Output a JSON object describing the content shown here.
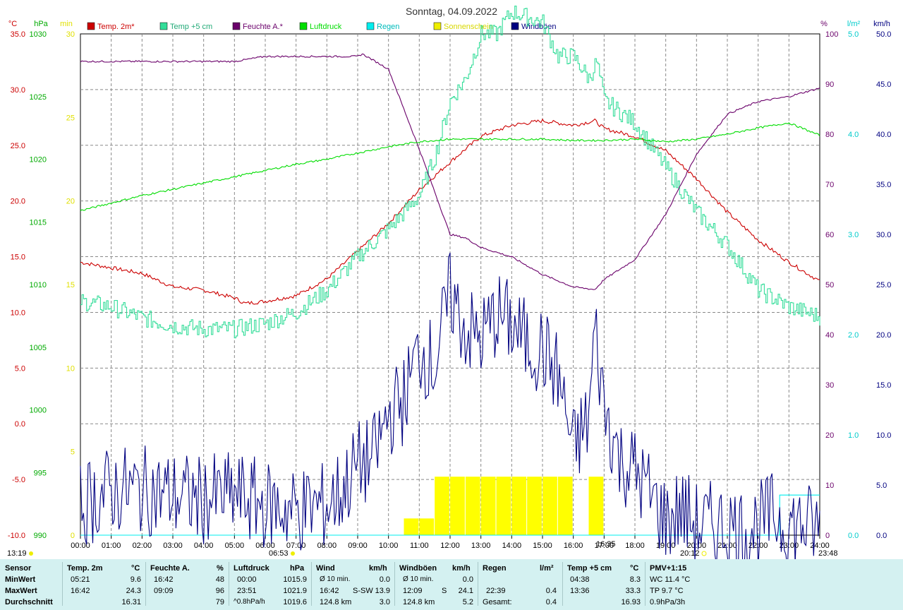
{
  "chart_data": {
    "type": "line",
    "title": "Sonntag, 04.09.2022",
    "left_axes": [
      {
        "unit": "°C",
        "color": "#cc0000",
        "ticks": [
          "35.0",
          "30.0",
          "25.0",
          "20.0",
          "15.0",
          "10.0",
          "5.0",
          "0.0",
          "-5.0",
          "-10.0"
        ],
        "range": [
          -10,
          35
        ]
      },
      {
        "unit": "hPa",
        "color": "#00aa00",
        "ticks": [
          "1030",
          "1025",
          "1020",
          "1015",
          "1010",
          "1005",
          "1000",
          "995",
          "990"
        ],
        "range": [
          990,
          1030
        ]
      },
      {
        "unit": "min",
        "color": "#e0e000",
        "ticks": [
          "30",
          "25",
          "20",
          "15",
          "10",
          "5",
          "0"
        ],
        "range": [
          0,
          30
        ]
      }
    ],
    "right_axes": [
      {
        "unit": "%",
        "color": "#6a006a",
        "ticks": [
          "100",
          "90",
          "80",
          "70",
          "60",
          "50",
          "40",
          "30",
          "20",
          "10",
          "0"
        ],
        "range": [
          0,
          100
        ]
      },
      {
        "unit": "l/m²",
        "color": "#00cccc",
        "ticks": [
          "5.0",
          "4.0",
          "3.0",
          "2.0",
          "1.0",
          "0.0"
        ],
        "range": [
          0,
          5
        ]
      },
      {
        "unit": "km/h",
        "color": "#000080",
        "ticks": [
          "50.0",
          "45.0",
          "40.0",
          "35.0",
          "30.0",
          "25.0",
          "20.0",
          "15.0",
          "10.0",
          "5.0",
          "0.0"
        ],
        "range": [
          0,
          50
        ]
      }
    ],
    "x_ticks": [
      "00:00",
      "01:00",
      "02:00",
      "03:00",
      "04:00",
      "05:00",
      "06:00",
      "07:00",
      "08:00",
      "09:00",
      "10:00",
      "11:00",
      "12:00",
      "13:00",
      "14:00",
      "15:00",
      "16:00",
      "17:00",
      "18:00",
      "19:00",
      "20:00",
      "21:00",
      "22:00",
      "23:00",
      "24:00"
    ],
    "markers": {
      "start": "13:19",
      "sunrise": "06:53",
      "sunset": "20:12",
      "peak": "16:35",
      "end": "23:48"
    },
    "legend": [
      {
        "name": "Temp. 2m*",
        "color": "#cc0000"
      },
      {
        "name": "Temp +5 cm",
        "color": "#33dd99"
      },
      {
        "name": "Feuchte A.*",
        "color": "#6a006a"
      },
      {
        "name": "Luftdruck",
        "color": "#00dd00"
      },
      {
        "name": "Regen",
        "color": "#00eeee"
      },
      {
        "name": "Sonnenschein",
        "color": "#eeee00"
      },
      {
        "name": "Windböen",
        "color": "#000080"
      }
    ],
    "series": [
      {
        "name": "Temp. 2m*",
        "axis": "°C",
        "x": [
          0,
          1,
          2,
          3,
          4,
          5,
          5.35,
          6,
          7,
          8,
          9,
          10,
          11,
          12,
          13,
          14,
          15,
          15.5,
          16,
          16.7,
          17,
          18,
          19,
          20,
          21,
          22,
          23,
          24
        ],
        "values": [
          14.5,
          14.0,
          13.5,
          12.3,
          12.0,
          11.3,
          10.8,
          11.0,
          11.5,
          13.0,
          15.5,
          18.0,
          21.0,
          23.5,
          25.8,
          26.8,
          27.2,
          27.0,
          26.8,
          27.2,
          26.5,
          25.8,
          24.5,
          22.0,
          19.0,
          16.5,
          14.5,
          12.8
        ]
      },
      {
        "name": "Temp +5 cm",
        "axis": "°C",
        "x": [
          0,
          1,
          2,
          3,
          4,
          5,
          6,
          7,
          8,
          9,
          10,
          11,
          11.5,
          12,
          12.5,
          13,
          13.5,
          14,
          14.5,
          15,
          15.5,
          16,
          16.5,
          16.75,
          17,
          18,
          19,
          20,
          21,
          22,
          23,
          24
        ],
        "values": [
          11.0,
          10.5,
          9.5,
          8.8,
          8.5,
          8.5,
          9.0,
          10.0,
          12.0,
          15.0,
          17.5,
          20.5,
          24.0,
          29.0,
          31.0,
          35.0,
          35.0,
          37.0,
          36.5,
          36.0,
          33.0,
          33.0,
          31.0,
          32.5,
          29.0,
          27.0,
          23.0,
          19.0,
          16.0,
          12.0,
          10.5,
          9.6
        ]
      },
      {
        "name": "Feuchte A.*",
        "axis": "%",
        "x": [
          0,
          1,
          2,
          3,
          4,
          5,
          6,
          7,
          8,
          9,
          9.15,
          10,
          11,
          12,
          12.5,
          13,
          14,
          15,
          16,
          16.7,
          17,
          18,
          19,
          20,
          21,
          22,
          23,
          24
        ],
        "values": [
          94.5,
          94.5,
          94.5,
          94.5,
          94.5,
          94.5,
          95.5,
          95.5,
          95.5,
          95.5,
          96,
          93,
          77,
          60,
          59.3,
          57.4,
          55.5,
          52.0,
          49.5,
          49.0,
          51.0,
          55.0,
          64.0,
          76.0,
          84.0,
          86.5,
          87.5,
          89.2
        ]
      },
      {
        "name": "Luftdruck",
        "axis": "hPa",
        "x": [
          0,
          1,
          2,
          3,
          4,
          5,
          6,
          7,
          8,
          9,
          10,
          11,
          12,
          13,
          14,
          15,
          16,
          17,
          18,
          19,
          20,
          21,
          22,
          23,
          24
        ],
        "values": [
          1015.9,
          1016.5,
          1017.1,
          1017.6,
          1018.1,
          1018.6,
          1019.1,
          1019.6,
          1020.0,
          1020.5,
          1021.0,
          1021.4,
          1021.6,
          1021.6,
          1021.6,
          1021.6,
          1021.5,
          1021.5,
          1021.6,
          1021.4,
          1021.6,
          1022.0,
          1022.5,
          1022.9,
          1021.9
        ]
      },
      {
        "name": "Regen",
        "axis": "l/m²",
        "x": [
          0,
          22.65,
          22.66,
          24
        ],
        "values": [
          0.0,
          0.0,
          0.4,
          0.4
        ]
      },
      {
        "name": "Windböen",
        "axis": "km/h",
        "x": [
          0,
          1,
          2,
          3,
          4,
          5,
          6,
          7,
          8,
          8.5,
          9,
          9.5,
          10,
          10.5,
          11,
          11.5,
          12,
          12.5,
          13,
          13.5,
          14,
          14.5,
          15,
          15.5,
          16,
          16.5,
          16.7,
          17,
          17.5,
          18,
          18.5,
          19,
          19.5,
          20,
          20.5,
          21,
          21.5,
          22,
          22.5,
          23,
          23.5,
          24
        ],
        "values": [
          3.0,
          4.5,
          4.5,
          4.0,
          3.5,
          4.0,
          3.0,
          2.5,
          3.0,
          4.5,
          7.0,
          7.5,
          12.0,
          13.5,
          18.5,
          17.0,
          24.1,
          20.5,
          19.5,
          22.0,
          21.0,
          19.0,
          18.5,
          16.0,
          8.5,
          11.5,
          20.5,
          13.0,
          7.5,
          6.5,
          4.0,
          1.5,
          2.5,
          1.0,
          1.0,
          1.0,
          0.5,
          1.0,
          2.0,
          1.0,
          1.0,
          0.5
        ]
      },
      {
        "name": "Sonnenschein",
        "axis": "min",
        "type": "bar",
        "x": [
          10.5,
          11,
          11.5,
          12,
          12.5,
          13,
          13.5,
          14,
          14.5,
          15,
          15.5,
          16.5
        ],
        "values": [
          1.0,
          1.0,
          3.5,
          3.5,
          3.5,
          3.5,
          3.5,
          3.5,
          3.5,
          3.5,
          3.5,
          3.5
        ]
      }
    ]
  },
  "stats": {
    "header": {
      "sensor": "Sensor",
      "temp": "Temp. 2m",
      "temp_unit": "°C",
      "hum": "Feuchte A.",
      "hum_unit": "%",
      "press": "Luftdruck",
      "press_unit": "hPa",
      "wind": "Wind",
      "wind_unit": "km/h",
      "gust": "Windböen",
      "gust_unit": "km/h",
      "rain": "Regen",
      "rain_unit": "l/m²",
      "temp5": "Temp +5 cm",
      "temp5_unit": "°C",
      "pmv": "PMV+1:15"
    },
    "labels": {
      "min": "MinWert",
      "max": "MaxWert",
      "avg": "Durchschnitt"
    },
    "min": {
      "temp_time": "05:21",
      "temp": "9.6",
      "hum_time": "16:42",
      "hum": "48",
      "press_time": "00:00",
      "press": "1015.9",
      "wind_label": "Ø 10 min.",
      "wind": "0.0",
      "gust_label": "Ø 10 min.",
      "gust": "0.0",
      "rain_time": "",
      "rain": "",
      "temp5_time": "04:38",
      "temp5": "8.3",
      "pmv": "WC 11.4 °C"
    },
    "max": {
      "temp_time": "16:42",
      "temp": "24.3",
      "hum_time": "09:09",
      "hum": "96",
      "press_time": "23:51",
      "press": "1021.9",
      "wind_time": "16:42",
      "wind_dir": "S-SW",
      "wind": "13.9",
      "gust_time": "12:09",
      "gust_dir": "S",
      "gust": "24.1",
      "rain_time": "22:39",
      "rain": "0.4",
      "temp5_time": "13:36",
      "temp5": "33.3",
      "pmv": "TP 9.7 °C"
    },
    "avg": {
      "temp": "16.31",
      "hum": "79",
      "press_label": "^0.8hPa/h",
      "press": "1019.6",
      "wind_label": "124.8 km",
      "wind": "3.0",
      "gust_label": "124.8 km",
      "gust": "5.2",
      "rain_label": "Gesamt:",
      "rain": "0.4",
      "temp5": "16.93",
      "pmv": "0.9hPa/3h"
    }
  }
}
